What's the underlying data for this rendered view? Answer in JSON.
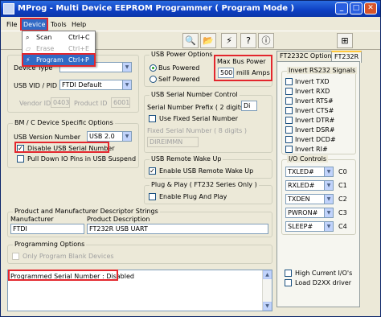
{
  "window": {
    "title": "MProg - Multi Device EEPROM Programmer ( Program Mode )"
  },
  "menu": {
    "file": "File",
    "device": "Device",
    "tools": "Tools",
    "help": "Help"
  },
  "device_menu": {
    "items": [
      {
        "label": "Scan",
        "shortcut": "Ctrl+C"
      },
      {
        "label": "Erase",
        "shortcut": "Ctrl+E"
      },
      {
        "label": "Program",
        "shortcut": "Ctrl+P"
      }
    ]
  },
  "basic": {
    "device_type_label": "Device Type",
    "usb_vid_pid_label": "USB VID / PID",
    "usb_vid_pid_value": "FTDI Default",
    "vendor_id_label": "Vendor ID",
    "vendor_id_value": "0403",
    "product_id_label": "Product ID",
    "product_id_value": "6001"
  },
  "bm_options": {
    "title": "BM / C Device Specific Options",
    "usb_version_label": "USB Version Number",
    "usb_version_value": "USB 2.0",
    "disable_serial": "Disable USB Serial Number",
    "pull_down": "Pull Down IO Pins in USB Suspend"
  },
  "power": {
    "title": "USB Power Options",
    "bus_powered": "Bus Powered",
    "self_powered": "Self Powered",
    "max_power_label": "Max Bus Power",
    "max_power_value": "500",
    "units": "milli Amps"
  },
  "serial": {
    "title": "USB Serial Number Control",
    "prefix_label": "Serial Number Prefix ( 2 digits )",
    "prefix_value": "Di",
    "use_fixed": "Use Fixed Serial Number",
    "fixed_label": "Fixed Serial Number ( 8 digits )",
    "fixed_value": "DIREIMMN"
  },
  "wakeup": {
    "title": "USB Remote Wake Up",
    "enable": "Enable USB Remote Wake Up"
  },
  "plug": {
    "title": "Plug & Play ( FT232 Series Only )",
    "enable": "Enable Plug And Play"
  },
  "strings": {
    "title": "Product and Manufacturer Descriptor Strings",
    "manufacturer_label": "Manufacturer",
    "manufacturer_value": "FTDI",
    "product_label": "Product Description",
    "product_value": "FT232R USB UART"
  },
  "programming": {
    "title": "Programming Options",
    "only_blank": "Only Program Blank Devices"
  },
  "status": {
    "text": "Programmed Serial Number : Disabled"
  },
  "tabs": {
    "tab1": "FT2232C Options",
    "tab2": "FT232R"
  },
  "invert": {
    "title": "Invert RS232 Signals",
    "items": [
      "Invert TXD",
      "Invert RXD",
      "Invert RTS#",
      "Invert CTS#",
      "Invert DTR#",
      "Invert DSR#",
      "Invert DCD#",
      "Invert RI#"
    ]
  },
  "io": {
    "title": "I/O Controls",
    "controls": [
      {
        "value": "TXLED#",
        "label": "C0"
      },
      {
        "value": "RXLED#",
        "label": "C1"
      },
      {
        "value": "TXDEN",
        "label": "C2"
      },
      {
        "value": "PWRON#",
        "label": "C3"
      },
      {
        "value": "SLEEP#",
        "label": "C4"
      }
    ]
  },
  "extra": {
    "high_current": "High Current I/O's",
    "load_d2xx": "Load D2XX driver"
  },
  "colors": {
    "highlight": "#e3262d",
    "title_bar": "#0d3fc2",
    "selection": "#316ac5"
  }
}
